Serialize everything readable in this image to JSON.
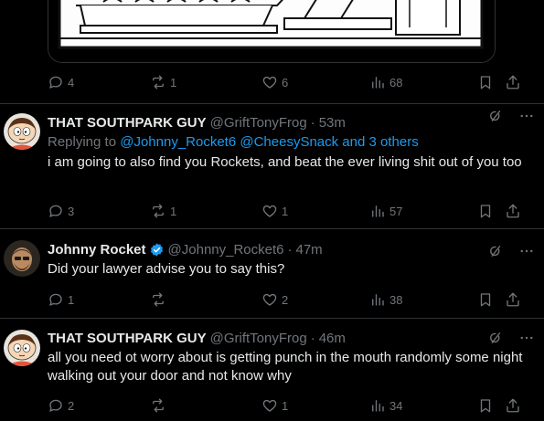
{
  "top_actions": {
    "replies": "4",
    "retweets": "1",
    "likes": "6",
    "views": "68"
  },
  "tweets": [
    {
      "name": "THAT SOUTHPARK GUY",
      "handle": "@GriftTonyFrog",
      "time": "53m",
      "reply_prefix": "Replying to ",
      "reply_mentions": "@Johnny_Rocket6 @CheesySnack and 3 others",
      "text": "i am going to also find you Rockets, and beat the ever living shit out of you too",
      "replies": "3",
      "retweets": "1",
      "likes": "1",
      "views": "57"
    },
    {
      "name": "Johnny Rocket",
      "handle": "@Johnny_Rocket6",
      "time": "47m",
      "text": "Did your lawyer advise you to say this?",
      "replies": "1",
      "retweets": "",
      "likes": "2",
      "views": "38"
    },
    {
      "name": "THAT SOUTHPARK GUY",
      "handle": "@GriftTonyFrog",
      "time": "46m",
      "text": "all you need ot worry about is getting punch in the mouth randomly some night walking out your door and not know why",
      "replies": "2",
      "retweets": "",
      "likes": "1",
      "views": "34"
    }
  ],
  "separator": "·",
  "colors": {
    "background": "#000000",
    "text": "#e7e9ea",
    "muted": "#71767b",
    "accent": "#1d9bf0",
    "divider": "#2f3336"
  }
}
